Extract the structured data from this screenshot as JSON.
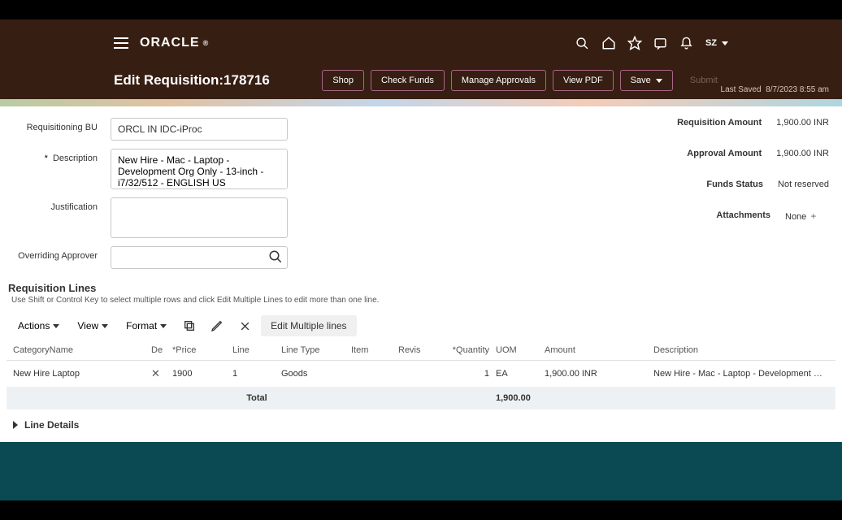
{
  "header": {
    "brand": "ORACLE",
    "user": "SZ"
  },
  "page": {
    "title": "Edit Requisition:178716",
    "actions": {
      "shop": "Shop",
      "check_funds": "Check Funds",
      "manage_approvals": "Manage Approvals",
      "view_pdf": "View PDF",
      "save": "Save",
      "submit": "Submit"
    },
    "last_saved_label": "Last Saved",
    "last_saved_value": "8/7/2023 8:55 am"
  },
  "form": {
    "bu_label": "Requisitioning BU",
    "bu_value": "ORCL IN IDC-iProc",
    "desc_label": "Description",
    "desc_value": "New Hire - Mac - Laptop - Development Org Only - 13-inch - i7/32/512 - ENGLISH US",
    "just_label": "Justification",
    "just_value": "",
    "approver_label": "Overriding Approver",
    "approver_value": ""
  },
  "summary": {
    "req_amount_label": "Requisition Amount",
    "req_amount_value": "1,900.00 INR",
    "appr_amount_label": "Approval Amount",
    "appr_amount_value": "1,900.00 INR",
    "funds_status_label": "Funds Status",
    "funds_status_value": "Not reserved",
    "attachments_label": "Attachments",
    "attachments_value": "None"
  },
  "lines_section": {
    "title": "Requisition Lines",
    "hint": "Use Shift or Control Key to select multiple rows and click Edit Multiple Lines to edit more than one line.",
    "actions": "Actions",
    "view": "View",
    "format": "Format",
    "edit_multiple": "Edit Multiple lines",
    "headers": {
      "category": "CategoryName",
      "de": "De",
      "price": "*Price",
      "line": "Line",
      "line_type": "Line Type",
      "item": "Item",
      "revis": "Revis",
      "qty": "*Quantity",
      "uom": "UOM",
      "amount": "Amount",
      "desc": "Description"
    },
    "rows": [
      {
        "category": "New Hire Laptop",
        "price": "1900",
        "line": "1",
        "line_type": "Goods",
        "item": "",
        "revis": "",
        "qty": "1",
        "uom": "EA",
        "amount": "1,900.00 INR",
        "desc": "New Hire - Mac - Laptop - Development Org Onl…"
      }
    ],
    "total_label": "Total",
    "total_value": "1,900.00"
  },
  "line_details": "Line Details"
}
